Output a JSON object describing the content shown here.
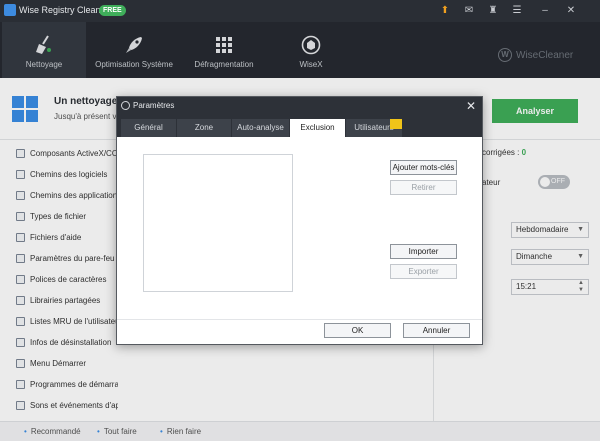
{
  "titlebar": {
    "app_title": "Wise Registry Cleaner 11",
    "badge": "FREE",
    "icons": [
      "upload-icon",
      "mail-icon",
      "shirt-icon",
      "menu-icon",
      "minimize-icon",
      "close-icon"
    ]
  },
  "nav": {
    "tabs": [
      {
        "label": "Nettoyage",
        "icon": "broom-icon",
        "active": true
      },
      {
        "label": "Optimisation Système",
        "icon": "rocket-icon",
        "active": false
      },
      {
        "label": "Défragmentation",
        "icon": "grid-icon",
        "active": false
      },
      {
        "label": "WiseX",
        "icon": "wisex-icon",
        "active": false
      }
    ],
    "brand": "WiseCleaner",
    "brand_mark": "W"
  },
  "banner": {
    "title": "Un nettoyage r",
    "subtitle": "Jusqu'à présent vou",
    "analyze_label": "Analyser"
  },
  "categories": [
    "Composants ActiveX/COM",
    "Chemins des logiciels",
    "Chemins des applications",
    "Types de fichier",
    "Fichiers d'aide",
    "Paramètres du pare-feu",
    "Polices de caractères",
    "Librairies partagées",
    "Listes MRU de l'utilisateur",
    "Infos de désinstallation",
    "Menu Démarrer",
    "Programmes de démarrage",
    "Sons et événements d'application"
  ],
  "right_panel": {
    "fixed_label": "corrigées :",
    "fixed_count": "0",
    "sched_label": "ateur",
    "toggle_label": "OFF",
    "frequency": "Hebdomadaire",
    "day": "Dimanche",
    "time": "15:21"
  },
  "status": {
    "items": [
      "Recommandé",
      "Tout faire",
      "Rien faire"
    ]
  },
  "dialog": {
    "title": "Paramètres",
    "close_glyph": "✕",
    "tabs": [
      "Général",
      "Zone",
      "Auto-analyse",
      "Exclusion",
      "Utilisateurs"
    ],
    "active_tab": "Exclusion",
    "add_key_label": "Ajouter mots-clés",
    "remove_label": "Retirer",
    "import_label": "Importer",
    "export_label": "Exporter",
    "ok_label": "OK",
    "cancel_label": "Annuler"
  },
  "colors": {
    "accent_green": "#3fae5a",
    "accent_blue": "#3a8ee6",
    "titlebar_bg": "#2a2e35",
    "navbar_bg": "#262a31"
  }
}
